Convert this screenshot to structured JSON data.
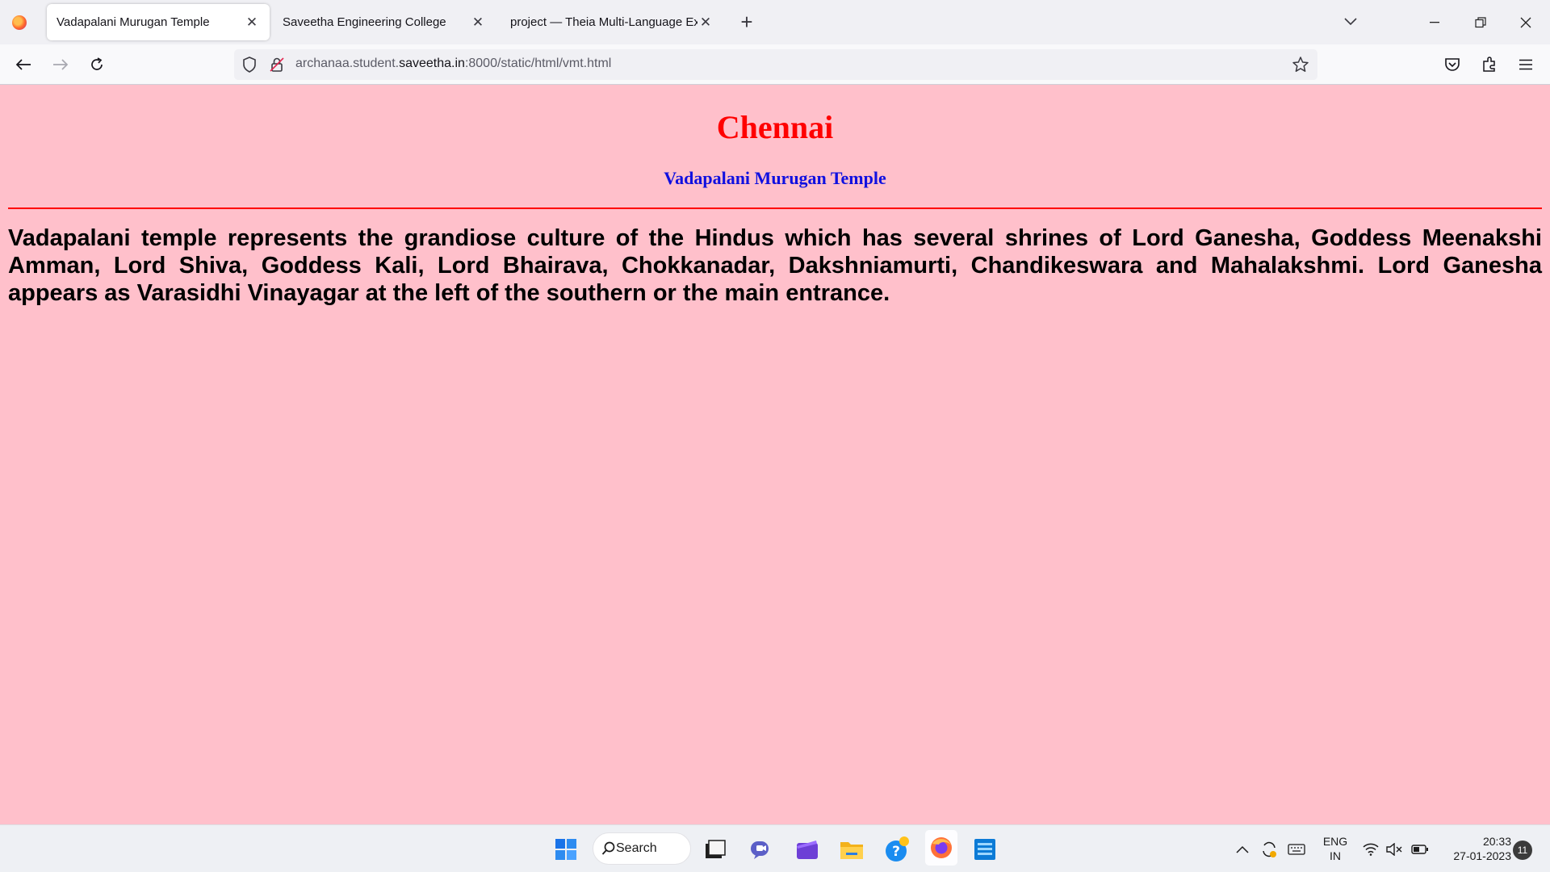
{
  "browser": {
    "tabs": [
      {
        "label": "Vadapalani Murugan Temple",
        "active": true
      },
      {
        "label": "Saveetha Engineering College",
        "active": false
      },
      {
        "label": "project — Theia Multi-Language Ex",
        "active": false
      }
    ],
    "new_tab_symbol": "+",
    "url": {
      "prefix": "archanaa.student.",
      "domain": "saveetha.in",
      "suffix": ":8000/static/html/vmt.html"
    }
  },
  "page": {
    "city_heading": "Chennai",
    "temple_heading": "Vadapalani Murugan Temple",
    "paragraph": "Vadapalani temple represents the grandiose culture of the Hindus which has several shrines of Lord Ganesha, Goddess Meenakshi Amman, Lord Shiva, Goddess Kali, Lord Bhairava, Chokkanadar, Dakshniamurti, Chandikeswara and Mahalakshmi. Lord Ganesha appears as Varasidhi Vinayagar at the left of the southern or the main entrance.",
    "background_color": "#ffc0cb",
    "heading_color": "#ff0000",
    "subheading_color": "#1010e0"
  },
  "taskbar": {
    "search_label": "Search",
    "language": {
      "line1": "ENG",
      "line2": "IN"
    },
    "clock": {
      "time": "20:33",
      "date": "27-01-2023"
    },
    "notification_count": "11"
  }
}
